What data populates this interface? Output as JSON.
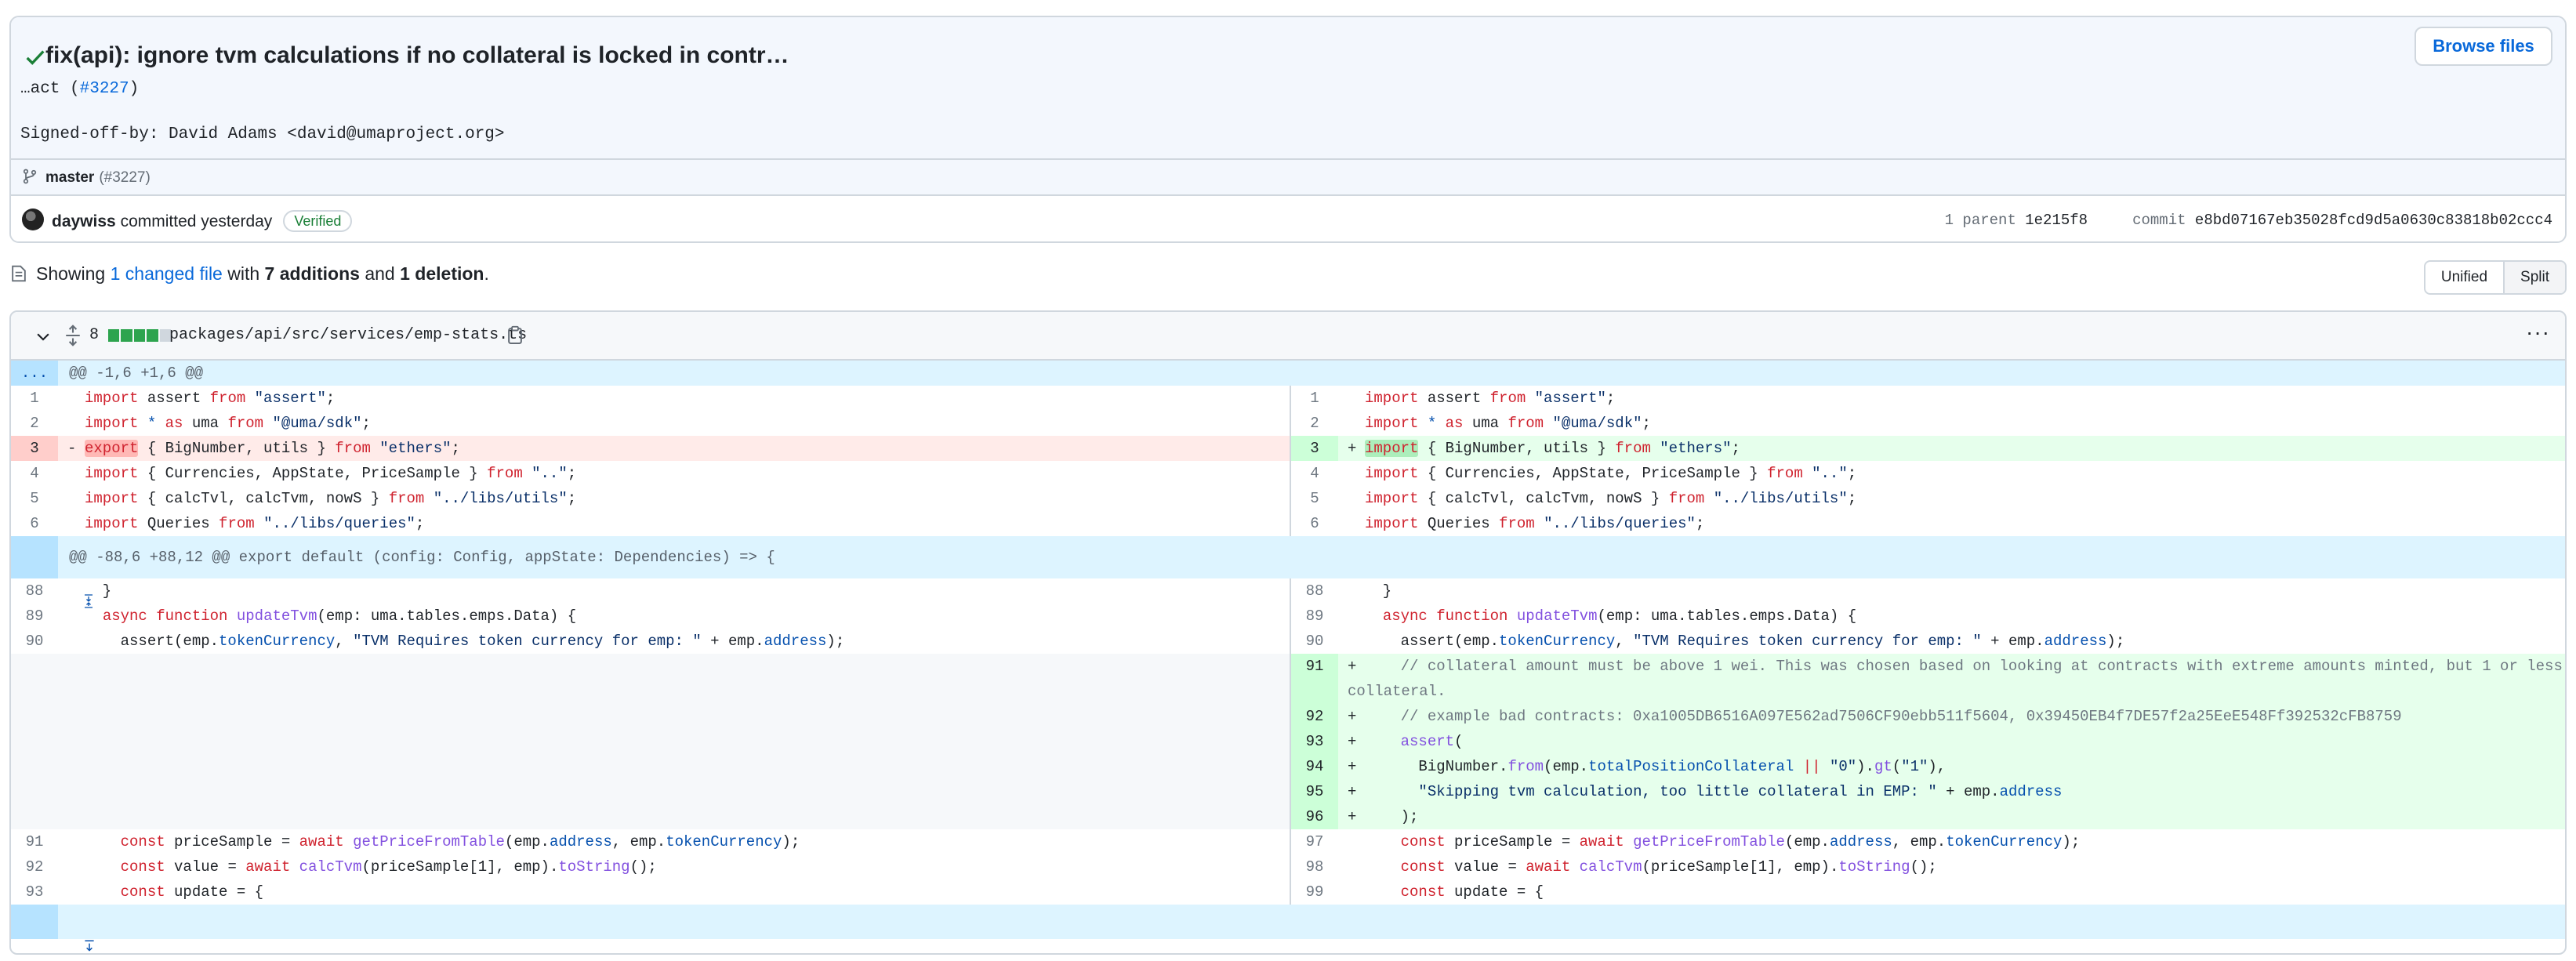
{
  "commit": {
    "title": "fix(api): ignore tvm calculations if no collateral is locked in contr…",
    "title_cont_prefix": "…act (",
    "title_cont_link": "#3227",
    "title_cont_suffix": ")",
    "signoff": "Signed-off-by: David Adams <david@umaproject.org>",
    "browse_label": "Browse files",
    "branch": "master",
    "branch_pr": "(#3227)",
    "author": "daywiss",
    "committed_text": "committed yesterday",
    "verified_label": "Verified",
    "parent_label": "1 parent",
    "parent_sha": "1e215f8",
    "commit_label": "commit",
    "commit_sha": "e8bd07167eb35028fcd9d5a0630c83818b02ccc4"
  },
  "summary": {
    "prefix": "Showing ",
    "changed": "1 changed file",
    "mid": " with ",
    "additions": "7 additions",
    "and": " and ",
    "deletions": "1 deletion",
    "end": "."
  },
  "view_toggle": {
    "unified": "Unified",
    "split": "Split",
    "active": "Split"
  },
  "file": {
    "change_count": "8",
    "path": "packages/api/src/services/emp-stats.ts",
    "diff_bar": [
      "add",
      "add",
      "add",
      "add",
      "neutral"
    ]
  },
  "hunks": {
    "first": "@@ -1,6 +1,6 @@",
    "second": "@@ -88,6 +88,12 @@ export default (config: Config, appState: Dependencies) => {",
    "expand_dots": "..."
  },
  "lines": {
    "l1": "1",
    "l2": "2",
    "l3": "3",
    "l4": "4",
    "l5": "5",
    "l6": "6",
    "l88": "88",
    "l89": "89",
    "l90": "90",
    "l91": "91",
    "l92": "92",
    "l93": "93",
    "r91": "91",
    "r92": "92",
    "r93": "93",
    "r94": "94",
    "r95": "95",
    "r96": "96",
    "r97": "97",
    "r98": "98",
    "r99": "99"
  },
  "code": {
    "c_comment1": "    // collateral amount must be above 1 wei. This was chosen based on looking at contracts with extreme amounts minted, but 1 or less collateral.",
    "c_comment2": "    // example bad contracts: 0xa1005DB6516A097E562ad7506CF90ebb511f5604, 0x39450EB4f7DE57f2a25EeE548Ff392532cFB8759"
  },
  "colors": {
    "add_bg": "#e6ffec",
    "del_bg": "#ffebe9",
    "hunk_bg": "#ddf4ff",
    "link": "#0969da",
    "verified": "#1a7f37",
    "bar_add": "#2da44e",
    "bar_neutral": "#d0d7de"
  }
}
